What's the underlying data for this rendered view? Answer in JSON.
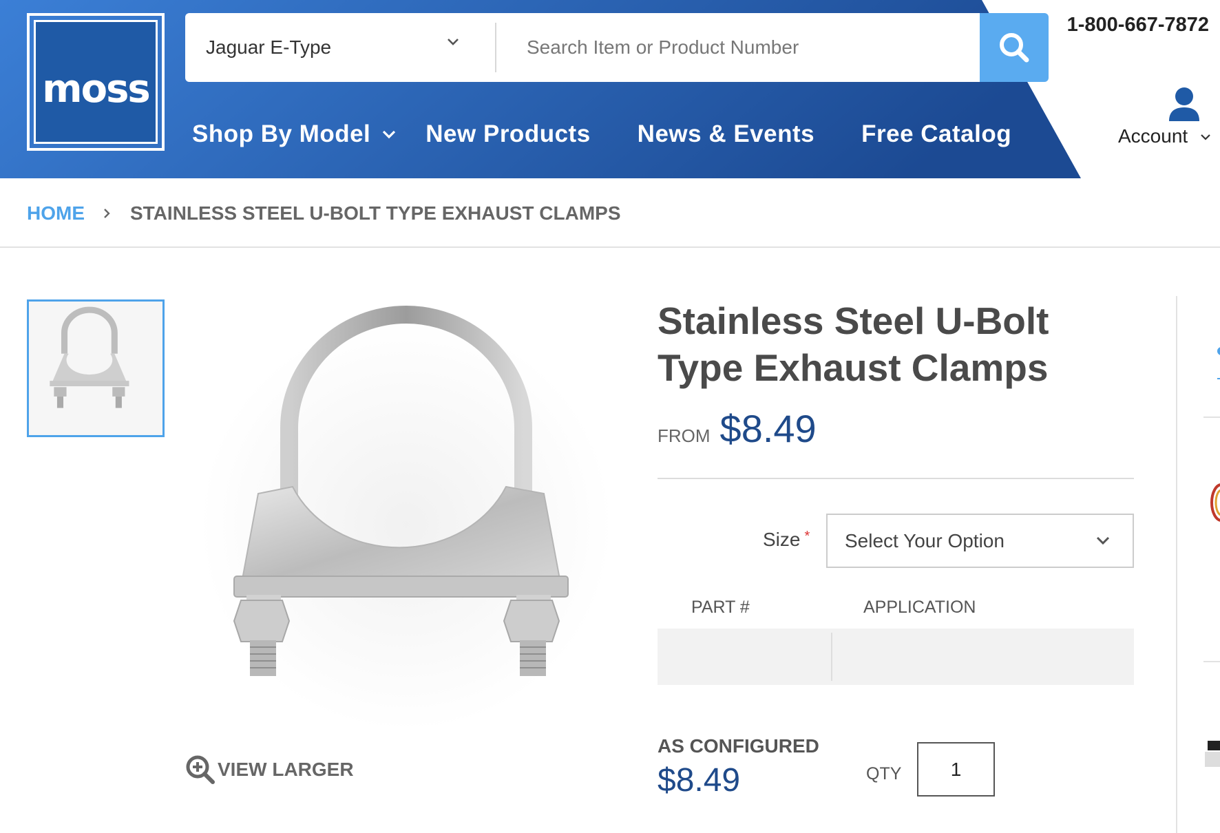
{
  "header": {
    "logo_text": "moss",
    "model_select": "Jaguar E-Type",
    "search_placeholder": "Search Item or Product Number",
    "phone": "1-800-667-7872",
    "account_label": "Account",
    "nav": [
      {
        "label": "Shop By Model"
      },
      {
        "label": "New Products"
      },
      {
        "label": "News & Events"
      },
      {
        "label": "Free Catalog"
      }
    ],
    "colors": {
      "header_left": "#3a7bd5",
      "header_right": "#1d4e97",
      "search_button": "#5aabf0"
    }
  },
  "breadcrumb": {
    "home": "HOME",
    "separator": "›",
    "current": "STAINLESS STEEL U-BOLT TYPE EXHAUST CLAMPS"
  },
  "gallery": {
    "view_larger": "VIEW LARGER"
  },
  "product": {
    "title": "Stainless Steel U-Bolt Type Exhaust Clamps",
    "from_label": "FROM",
    "price": "$8.49",
    "size_label": "Size",
    "required_mark": "*",
    "size_select": "Select Your Option",
    "table_headers": {
      "part": "PART #",
      "application": "APPLICATION"
    },
    "as_configured_label": "AS CONFIGURED",
    "configured_price": "$8.49",
    "qty_label": "QTY",
    "qty_value": "1",
    "colors": {
      "price": "#1f4a8a",
      "accent": "#4ea3ea"
    }
  }
}
